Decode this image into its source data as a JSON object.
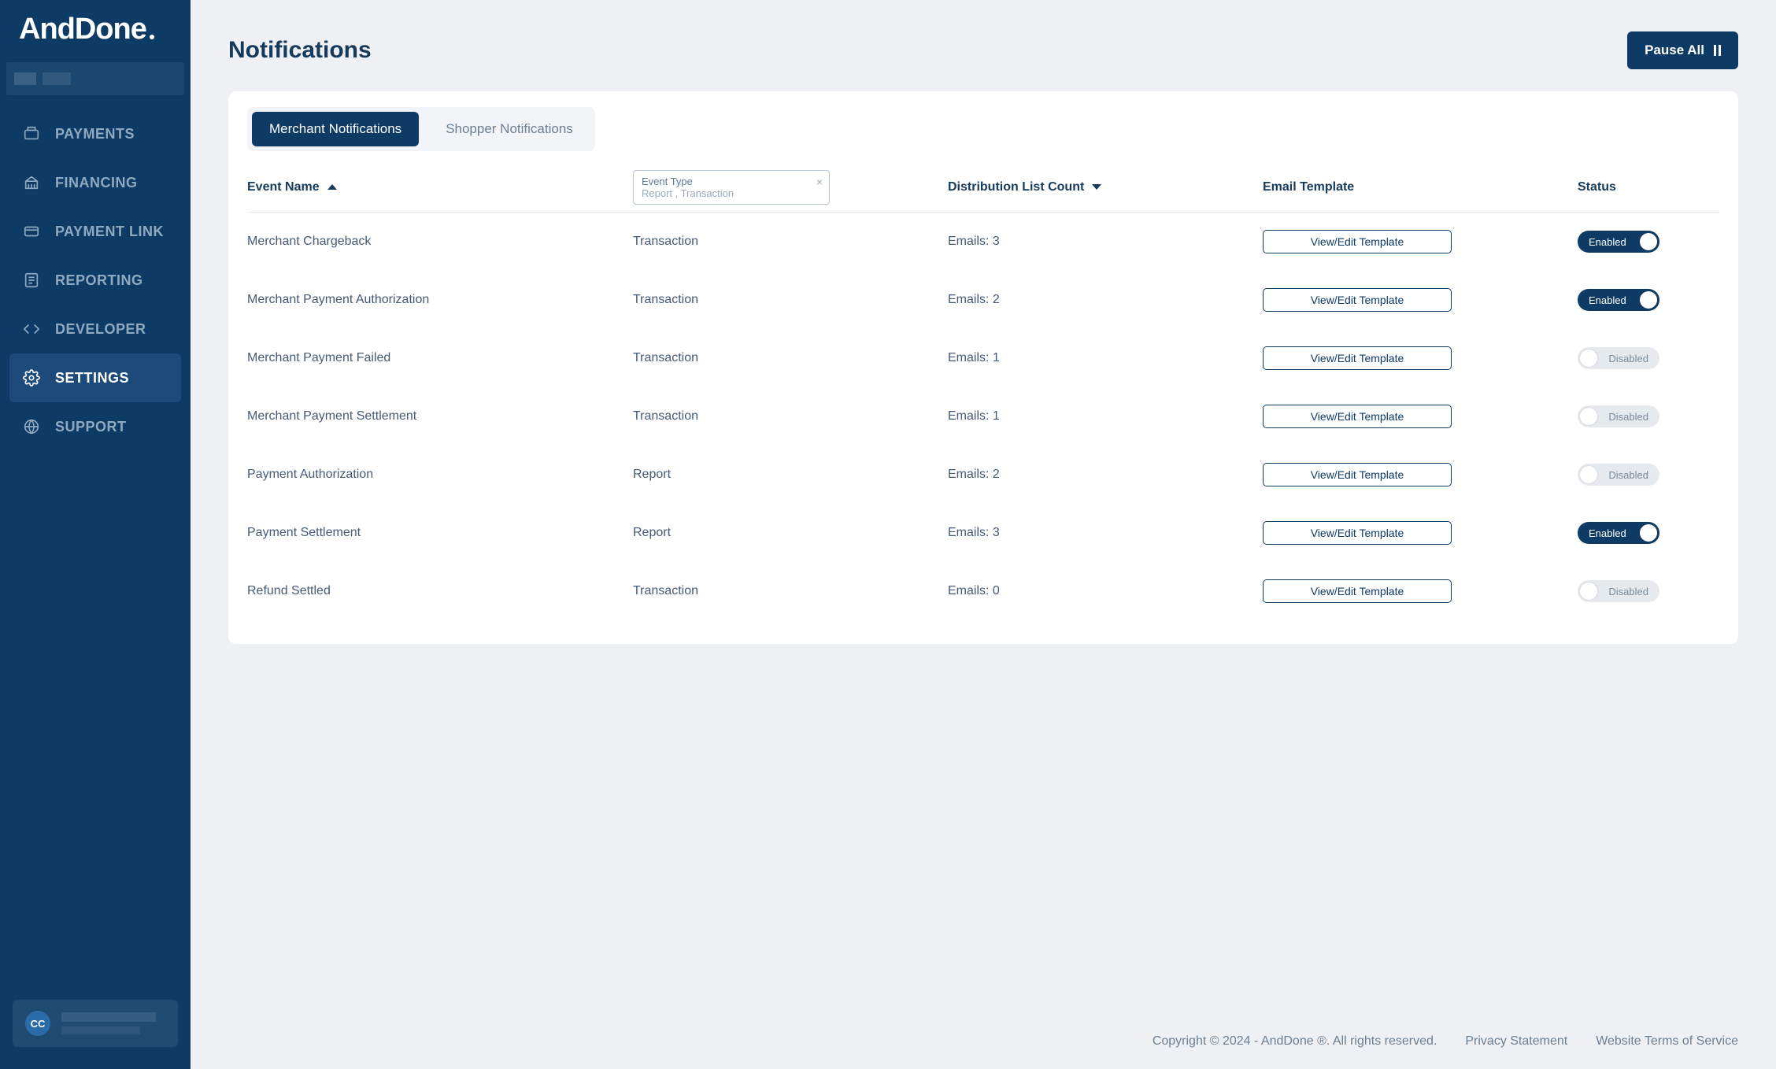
{
  "brand": "AndDone",
  "nav": {
    "payments": "PAYMENTS",
    "financing": "FINANCING",
    "payment_link": "PAYMENT LINK",
    "reporting": "REPORTING",
    "developer": "DEVELOPER",
    "settings": "SETTINGS",
    "support": "SUPPORT"
  },
  "user": {
    "initials": "CC"
  },
  "page": {
    "title": "Notifications",
    "pause_all": "Pause All"
  },
  "tabs": {
    "merchant": "Merchant Notifications",
    "shopper": "Shopper Notifications"
  },
  "columns": {
    "event_name": "Event Name",
    "event_type": "Event Type",
    "event_type_filter_value": "Report , Transaction",
    "distribution": "Distribution List Count",
    "template": "Email Template",
    "status": "Status"
  },
  "template_button_label": "View/Edit Template",
  "status_labels": {
    "enabled": "Enabled",
    "disabled": "Disabled"
  },
  "rows": [
    {
      "name": "Merchant Chargeback",
      "type": "Transaction",
      "dist": "Emails: 3",
      "enabled": true
    },
    {
      "name": "Merchant Payment Authorization",
      "type": "Transaction",
      "dist": "Emails: 2",
      "enabled": true
    },
    {
      "name": "Merchant Payment Failed",
      "type": "Transaction",
      "dist": "Emails: 1",
      "enabled": false
    },
    {
      "name": "Merchant Payment Settlement",
      "type": "Transaction",
      "dist": "Emails: 1",
      "enabled": false
    },
    {
      "name": "Payment Authorization",
      "type": "Report",
      "dist": "Emails: 2",
      "enabled": false
    },
    {
      "name": "Payment Settlement",
      "type": "Report",
      "dist": "Emails: 3",
      "enabled": true
    },
    {
      "name": "Refund Settled",
      "type": "Transaction",
      "dist": "Emails: 0",
      "enabled": false
    }
  ],
  "footer": {
    "copyright": "Copyright © 2024 - AndDone ®. All rights reserved.",
    "privacy": "Privacy Statement",
    "terms": "Website Terms of Service"
  }
}
